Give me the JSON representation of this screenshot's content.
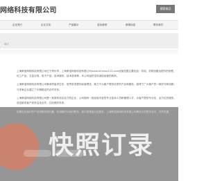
{
  "header": {
    "company_name": "网络科技有限公司",
    "search_label": "搜索商品"
  },
  "nav": {
    "items": [
      {
        "label": "企业简介"
      },
      {
        "label": "企业文化"
      },
      {
        "label": "产品展示"
      },
      {
        "label": "成功案例"
      },
      {
        "label": "新闻动态"
      },
      {
        "label": "联系我们"
      }
    ]
  },
  "breadcrumb": {
    "text": "简介"
  },
  "article": {
    "paragraphs": [
      "上海荣诺网络科技有限公司位于郑州市，上海荣诺网络科技有限公司www.lichenqi123.com经营范围主要包括：机电、机械设备及配件的销售、化工产品、五金交电、电子产品、技术服务、技术咨询等，本公司始终坚持诚信经营的原则。",
      "上海荣诺网络科技有限公司秉承质量求生存，信誉求发展的经营理念，致力于为客户提供优质的产品和服务，赢得了广大客户的一致好评和信赖，与多家企业建立了长期稳定的合作关系。",
      "上海荣诺网络科技有限公司是一家具有综合实力的企业，公司拥有一批经验丰富的专业技术人员和管理人才，为客户提供专业化、全方位的服务，欢迎新老客户前来洽谈合作，共创美好未来。"
    ]
  },
  "overlay": {
    "text": "如果您对我们的产品或服务感兴趣，欢迎随时与我们联系，我们将竭诚为您服务。上海荣诺网络科技有限公司期待与您携手合作，共同发展。",
    "watermark": "快照订录",
    "avatar_color": "#c9836e"
  }
}
